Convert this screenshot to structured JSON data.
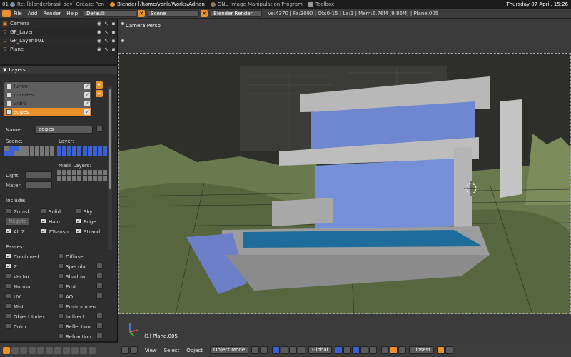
{
  "taskbar": {
    "workspace": "01",
    "tasks": [
      {
        "label": "Re: [blenderbrasil-dev] Grease Pen"
      },
      {
        "label": "Blender [/home/yorik/Works/Adrian"
      },
      {
        "label": "GNU Image Manipulation Program"
      },
      {
        "label": "Toolbox"
      }
    ],
    "clock": "Thursday 07 April, 15:26"
  },
  "info_header": {
    "menus": [
      "File",
      "Add",
      "Render",
      "Help"
    ],
    "screen": "Default",
    "scene": "Scene",
    "engine": "Blender Render",
    "close_glyph": "✕",
    "stats": "Ve:4370 | Fa:3090 | Ob:0-15 | La:1 | Mem:6.76M (9.86M) | Plane.005"
  },
  "outliner": {
    "items": [
      {
        "label": "Camera",
        "icon": "camera-icon"
      },
      {
        "label": "GP_Layer",
        "icon": "grease-pencil-icon"
      },
      {
        "label": "GP_Layer.001",
        "icon": "grease-pencil-icon"
      },
      {
        "label": "Plane",
        "icon": "mesh-icon"
      }
    ]
  },
  "layers_panel": {
    "title": "Layers",
    "render_layers": [
      {
        "label": "fundo",
        "enabled": true
      },
      {
        "label": "paredes",
        "enabled": true
      },
      {
        "label": "vidro",
        "enabled": true
      },
      {
        "label": "edges",
        "enabled": true,
        "selected": true
      }
    ],
    "add_glyph": "+",
    "remove_glyph": "−",
    "name_label": "Name:",
    "name_value": "edges",
    "scene_label": "Scene:",
    "layer_label": "Layer:",
    "mask_layers_label": "Mask Layers:",
    "light_label": "Light:",
    "material_label": "Materi",
    "include_label": "Include:",
    "include": [
      {
        "label": "Zmask",
        "checked": false
      },
      {
        "label": "Solid",
        "checked": false
      },
      {
        "label": "Sky",
        "checked": false
      },
      {
        "label": "Negate",
        "checked": false
      },
      {
        "label": "Halo",
        "checked": true
      },
      {
        "label": "Edge",
        "checked": true
      },
      {
        "label": "All Z",
        "checked": true
      },
      {
        "label": "ZTransp",
        "checked": true
      },
      {
        "label": "Strand",
        "checked": true
      }
    ],
    "passes_label": "Passes:",
    "passes_left": [
      {
        "label": "Combined",
        "checked": true
      },
      {
        "label": "Z",
        "checked": true
      },
      {
        "label": "Vector",
        "checked": false
      },
      {
        "label": "Normal",
        "checked": false
      },
      {
        "label": "UV",
        "checked": false
      },
      {
        "label": "Mist",
        "checked": false
      },
      {
        "label": "Object Index",
        "checked": false
      },
      {
        "label": "Color",
        "checked": false
      }
    ],
    "passes_right": [
      {
        "label": "Diffuse",
        "checked": false
      },
      {
        "label": "Specular",
        "checked": false
      },
      {
        "label": "Shadow",
        "checked": false
      },
      {
        "label": "Emit",
        "checked": false
      },
      {
        "label": "AO",
        "checked": false
      },
      {
        "label": "Environmen",
        "checked": false
      },
      {
        "label": "Indirect",
        "checked": false
      },
      {
        "label": "Reflection",
        "checked": false
      },
      {
        "label": "Refraction",
        "checked": false
      }
    ]
  },
  "viewport": {
    "title": "Camera Persp",
    "object_label": "(1) Plane.005"
  },
  "viewport_header": {
    "menus": [
      "View",
      "Select",
      "Object"
    ],
    "mode": "Object Mode",
    "orientation": "Global",
    "snap": "Closest"
  },
  "colors": {
    "accent": "#e8912d",
    "selected_blue": "#3a62d8",
    "panel_bg": "#2e2e2e"
  }
}
